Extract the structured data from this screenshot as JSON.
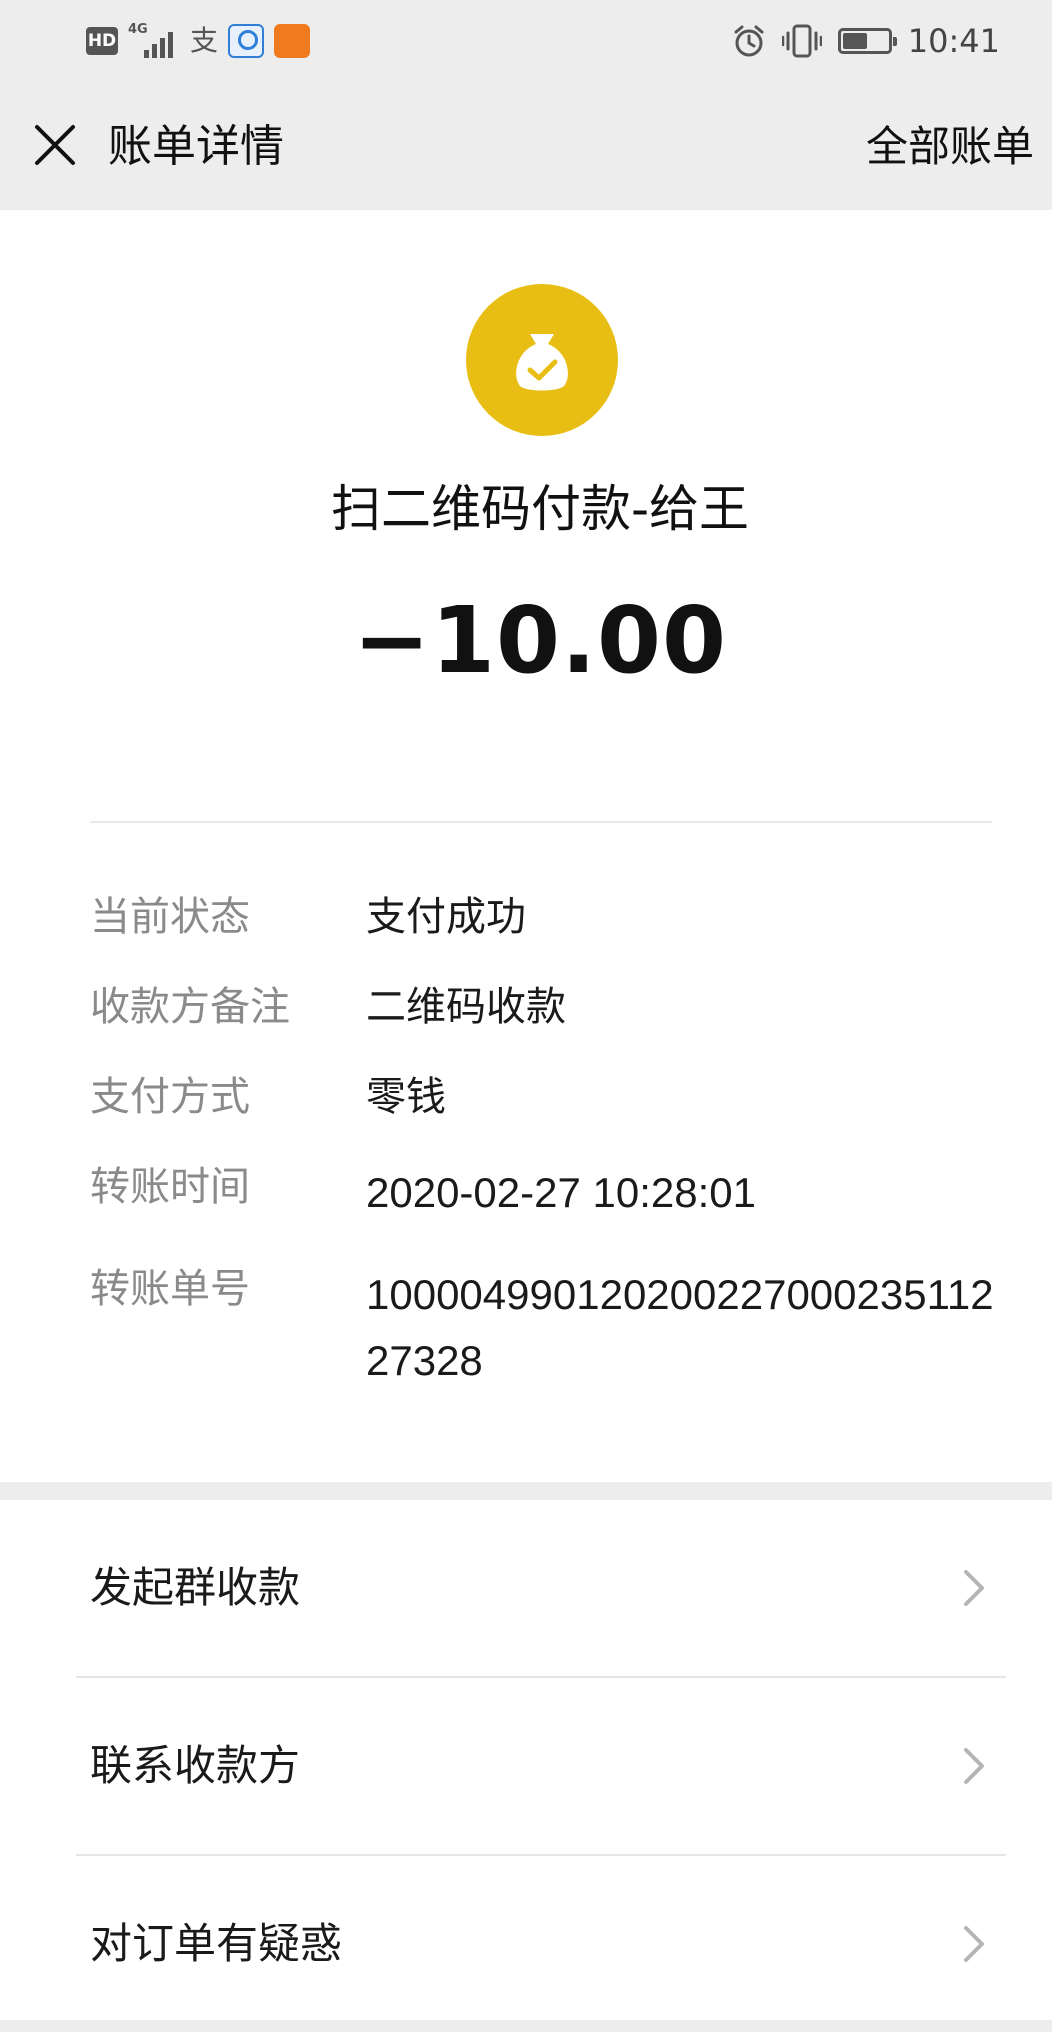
{
  "status_bar": {
    "hd_label": "HD",
    "network_label": "4G",
    "alipay_icon": "alipay-icon",
    "time": "10:41",
    "battery_level": 0.55
  },
  "nav": {
    "title": "账单详情",
    "all_bills": "全部账单",
    "close_icon": "close-icon"
  },
  "payment": {
    "icon": "money-bag-check-icon",
    "icon_color": "#e8be14",
    "merchant": "扫二维码付款-给王",
    "amount": "−10.00"
  },
  "details": [
    {
      "label": "当前状态",
      "value": "支付成功"
    },
    {
      "label": "收款方备注",
      "value": "二维码收款"
    },
    {
      "label": "支付方式",
      "value": "零钱"
    },
    {
      "label": "转账时间",
      "value": "2020-02-27 10:28:01"
    },
    {
      "label": "转账单号",
      "value": "100004990120200227000235112 27328"
    }
  ],
  "actions": [
    {
      "label": "发起群收款"
    },
    {
      "label": "联系收款方"
    },
    {
      "label": "对订单有疑惑"
    }
  ]
}
